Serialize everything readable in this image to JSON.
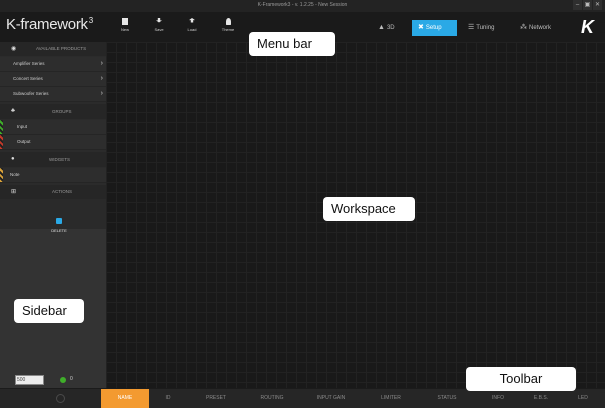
{
  "window": {
    "title": "K-Framework3 - v. 1.2.25 - New Session",
    "controls": [
      "–",
      "▣",
      "✕"
    ]
  },
  "menubar": {
    "logo_text": "K-framework",
    "logo_sup": "3",
    "buttons": [
      {
        "label": "New",
        "icon": "new-file-icon"
      },
      {
        "label": "Save",
        "icon": "save-icon"
      },
      {
        "label": "Load",
        "icon": "load-icon"
      },
      {
        "label": "Theme",
        "icon": "theme-icon"
      }
    ],
    "views": [
      {
        "label": "3D",
        "glyph": "▲"
      },
      {
        "label": "Setup",
        "glyph": "✖"
      },
      {
        "label": "Tuning",
        "glyph": "☰"
      },
      {
        "label": "Network",
        "glyph": "⁂"
      }
    ],
    "brand": "K",
    "accent": "#2aa9e6"
  },
  "sidebar": {
    "available_products": {
      "label": "AVAILABLE PRODUCTS",
      "items": [
        "Amplifier Series",
        "Concert Series",
        "Subwoofer Series"
      ]
    },
    "groups": {
      "label": "GROUPS",
      "items": [
        "Input",
        "Output"
      ]
    },
    "widgets": {
      "label": "WIDGETS",
      "items": [
        "Note"
      ]
    },
    "actions": {
      "label": "ACTIONS",
      "delete_label": "DELETE"
    },
    "count_value": "500",
    "online_count": "0"
  },
  "toolbar": {
    "columns": [
      "NAME",
      "ID",
      "PRESET",
      "ROUTING",
      "INPUT GAIN",
      "LIMITER",
      "STATUS",
      "INFO",
      "E.B.S.",
      "LED"
    ],
    "active_color": "#f39a30"
  },
  "callouts": {
    "menu_bar": "Menu bar",
    "workspace": "Workspace",
    "sidebar": "Sidebar",
    "toolbar": "Toolbar"
  }
}
